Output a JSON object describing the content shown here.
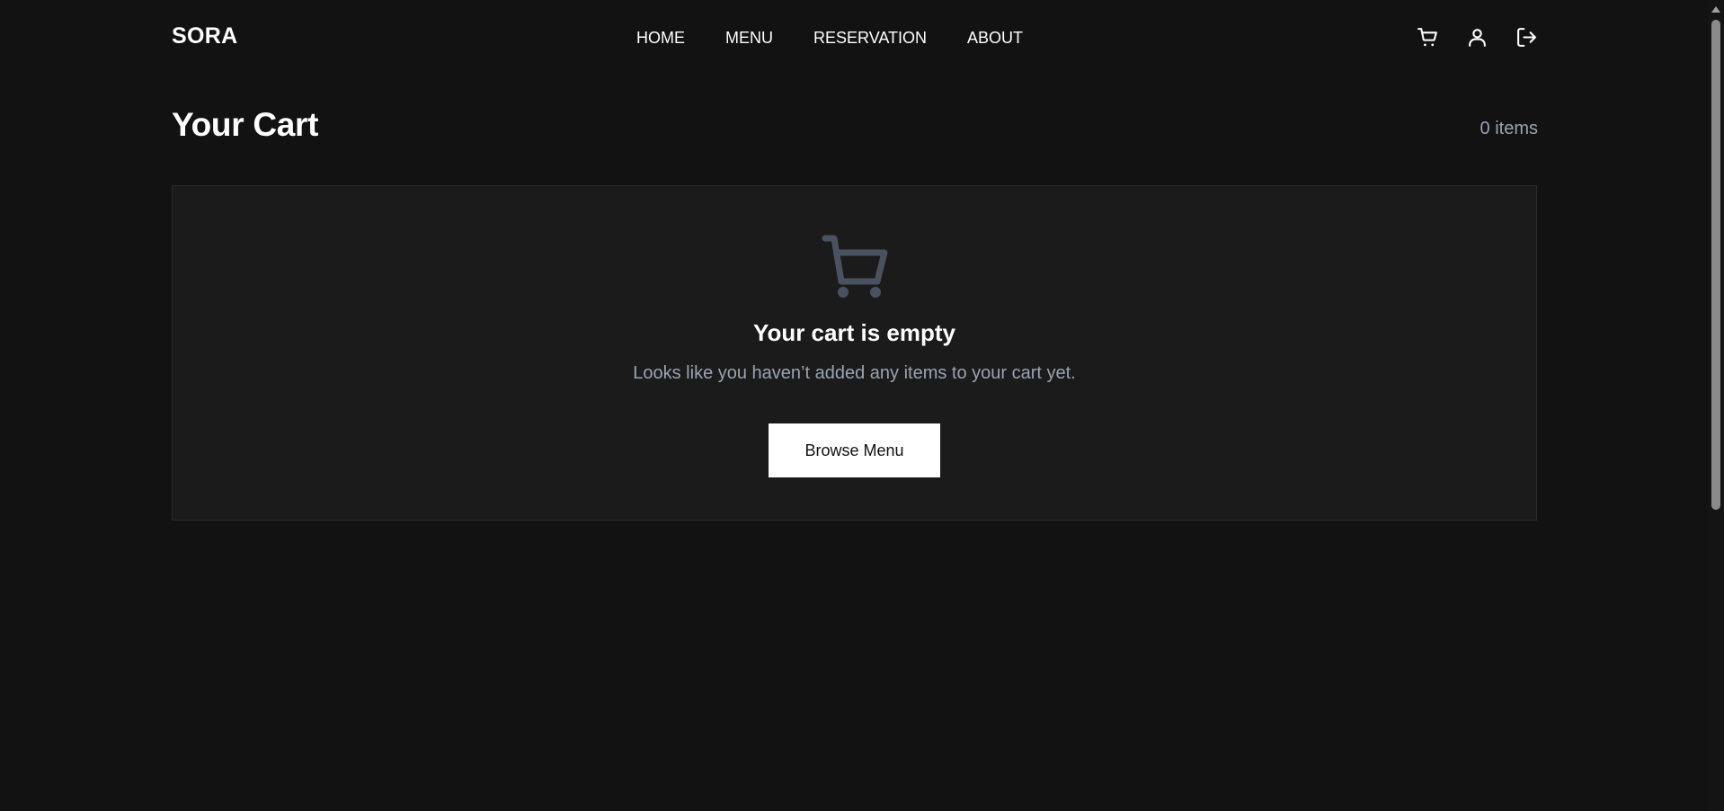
{
  "nav": {
    "logo": "SORA",
    "links": [
      "HOME",
      "MENU",
      "RESERVATION",
      "ABOUT"
    ],
    "icons": [
      "cart-icon",
      "user-icon",
      "logout-icon"
    ]
  },
  "cart": {
    "title": "Your Cart",
    "count": "0 items"
  },
  "empty": {
    "icon": "cart-icon",
    "title": "Your cart is empty",
    "description": "Looks like you haven’t added any items to your cart yet.",
    "button_label": "Browse Menu"
  },
  "colors": {
    "background": "#121212",
    "panel": "#1b1b1b",
    "muted_text": "#9aa3b2",
    "empty_icon": "#4a5160",
    "button_bg": "#ffffff"
  }
}
